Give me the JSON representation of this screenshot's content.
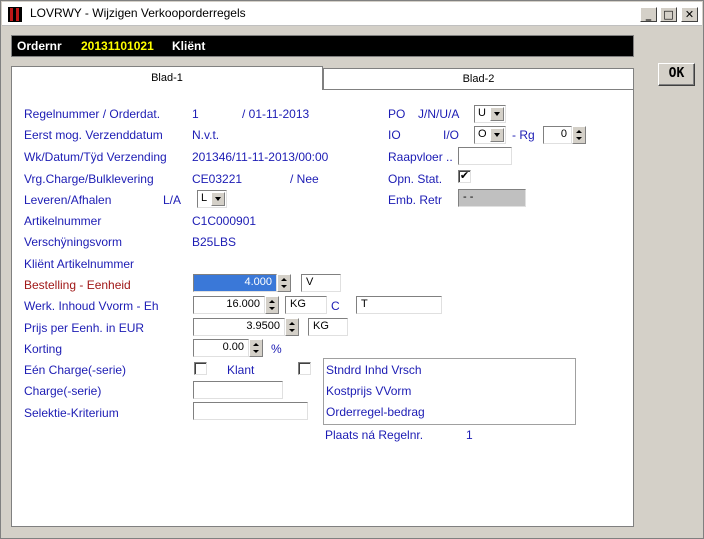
{
  "window": {
    "title": "LOVRWY - Wijzigen Verkooporderregels",
    "minimize": "_",
    "maximize": "□",
    "close": "✕"
  },
  "order": {
    "label": "Ordernr",
    "number": "20131101021",
    "client_label": "Kliënt",
    "label_color": "#ffffff",
    "number_color": "#ffff00"
  },
  "tabs": [
    {
      "label": "Blad-1",
      "active": true
    },
    {
      "label": "Blad-2",
      "active": false
    }
  ],
  "ok_button": "OK",
  "form": {
    "regelnummer": {
      "label": "Regelnummer / Orderdat.",
      "value": "1",
      "date": "/ 01-11-2013"
    },
    "eerst_mog": {
      "label": "Eerst mog. Verzenddatum",
      "value": "N.v.t."
    },
    "wk_datum": {
      "label": "Wk/Datum/Tÿd Verzending",
      "value": "201346/11-11-2013/00:00"
    },
    "vrg_charge": {
      "label": "Vrg.Charge/Bulklevering",
      "value": "CE03221",
      "extra": "/ Nee"
    },
    "leveren": {
      "label": "Leveren/Afhalen",
      "sub": "L/A",
      "value": "L"
    },
    "artikelnummer": {
      "label": "Artikelnummer",
      "value": "C1C000901"
    },
    "verschijningsvorm": {
      "label": "Verschÿningsvorm",
      "value": "B25LBS"
    },
    "klient_artikel": {
      "label": "Kliënt Artikelnummer"
    },
    "bestelling": {
      "label": "Bestelling - Eenheid",
      "value": "4.000",
      "unit": "V"
    },
    "werk_inhoud": {
      "label": "Werk. Inhoud Vvorm - Eh",
      "value": "16.000",
      "unit": "KG",
      "c_label": "C",
      "c_value": "T"
    },
    "prijs": {
      "label": "Prijs per Eenh. in EUR",
      "value": "3.9500",
      "unit": "KG"
    },
    "korting": {
      "label": "Korting",
      "value": "0.00",
      "unit": "%"
    },
    "een_charge": {
      "label": "Eén Charge(-serie)",
      "klant_label": "Klant"
    },
    "charge_serie": {
      "label": "Charge(-serie)",
      "value": ""
    },
    "selektie": {
      "label": "Selektie-Kriterium",
      "value": ""
    },
    "po": {
      "label": "PO",
      "sub": "J/N/U/A",
      "value": "U"
    },
    "io": {
      "label": "IO",
      "sub": "I/O",
      "value": "O",
      "rg_label": "- Rg",
      "rg_value": "0"
    },
    "raapvloer": {
      "label": "Raapvloer ..",
      "value": ""
    },
    "opn_stat": {
      "label": "Opn. Stat.",
      "checked": "✔"
    },
    "emb_retr": {
      "label": "Emb. Retr",
      "value": "- -"
    },
    "info": {
      "std_inhd": "Stndrd Inhd Vrsch",
      "kostprijs": "Kostprijs VVorm",
      "orderregel": "Orderregel-bedrag"
    },
    "plaats": {
      "label": "Plaats ná Regelnr.",
      "value": "1"
    }
  },
  "colors": {
    "label_blue": "#1c1cb4",
    "label_red": "#a01818",
    "selected_field": "#3a78d8"
  }
}
